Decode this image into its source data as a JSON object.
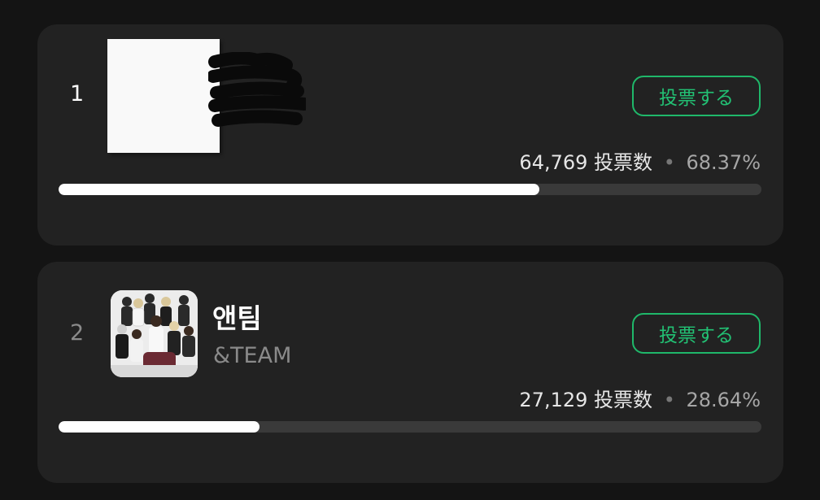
{
  "colors": {
    "background": "#141414",
    "card": "#222222",
    "accent_green": "#1fb86a",
    "bar_fill": "#ffffff",
    "bar_track": "#3a3a3a"
  },
  "entries": [
    {
      "rank": "1",
      "name": "",
      "subtitle": "",
      "thumbnail": "redacted-image",
      "vote_button_label": "投票する",
      "votes": "64,769",
      "votes_label": "投票数",
      "separator": "•",
      "percent": "68.37%",
      "progress_fraction": 0.6837
    },
    {
      "rank": "2",
      "name": "앤팀",
      "subtitle": "&TEAM",
      "thumbnail": "group-photo",
      "vote_button_label": "投票する",
      "votes": "27,129",
      "votes_label": "投票数",
      "separator": "•",
      "percent": "28.64%",
      "progress_fraction": 0.2864
    }
  ]
}
